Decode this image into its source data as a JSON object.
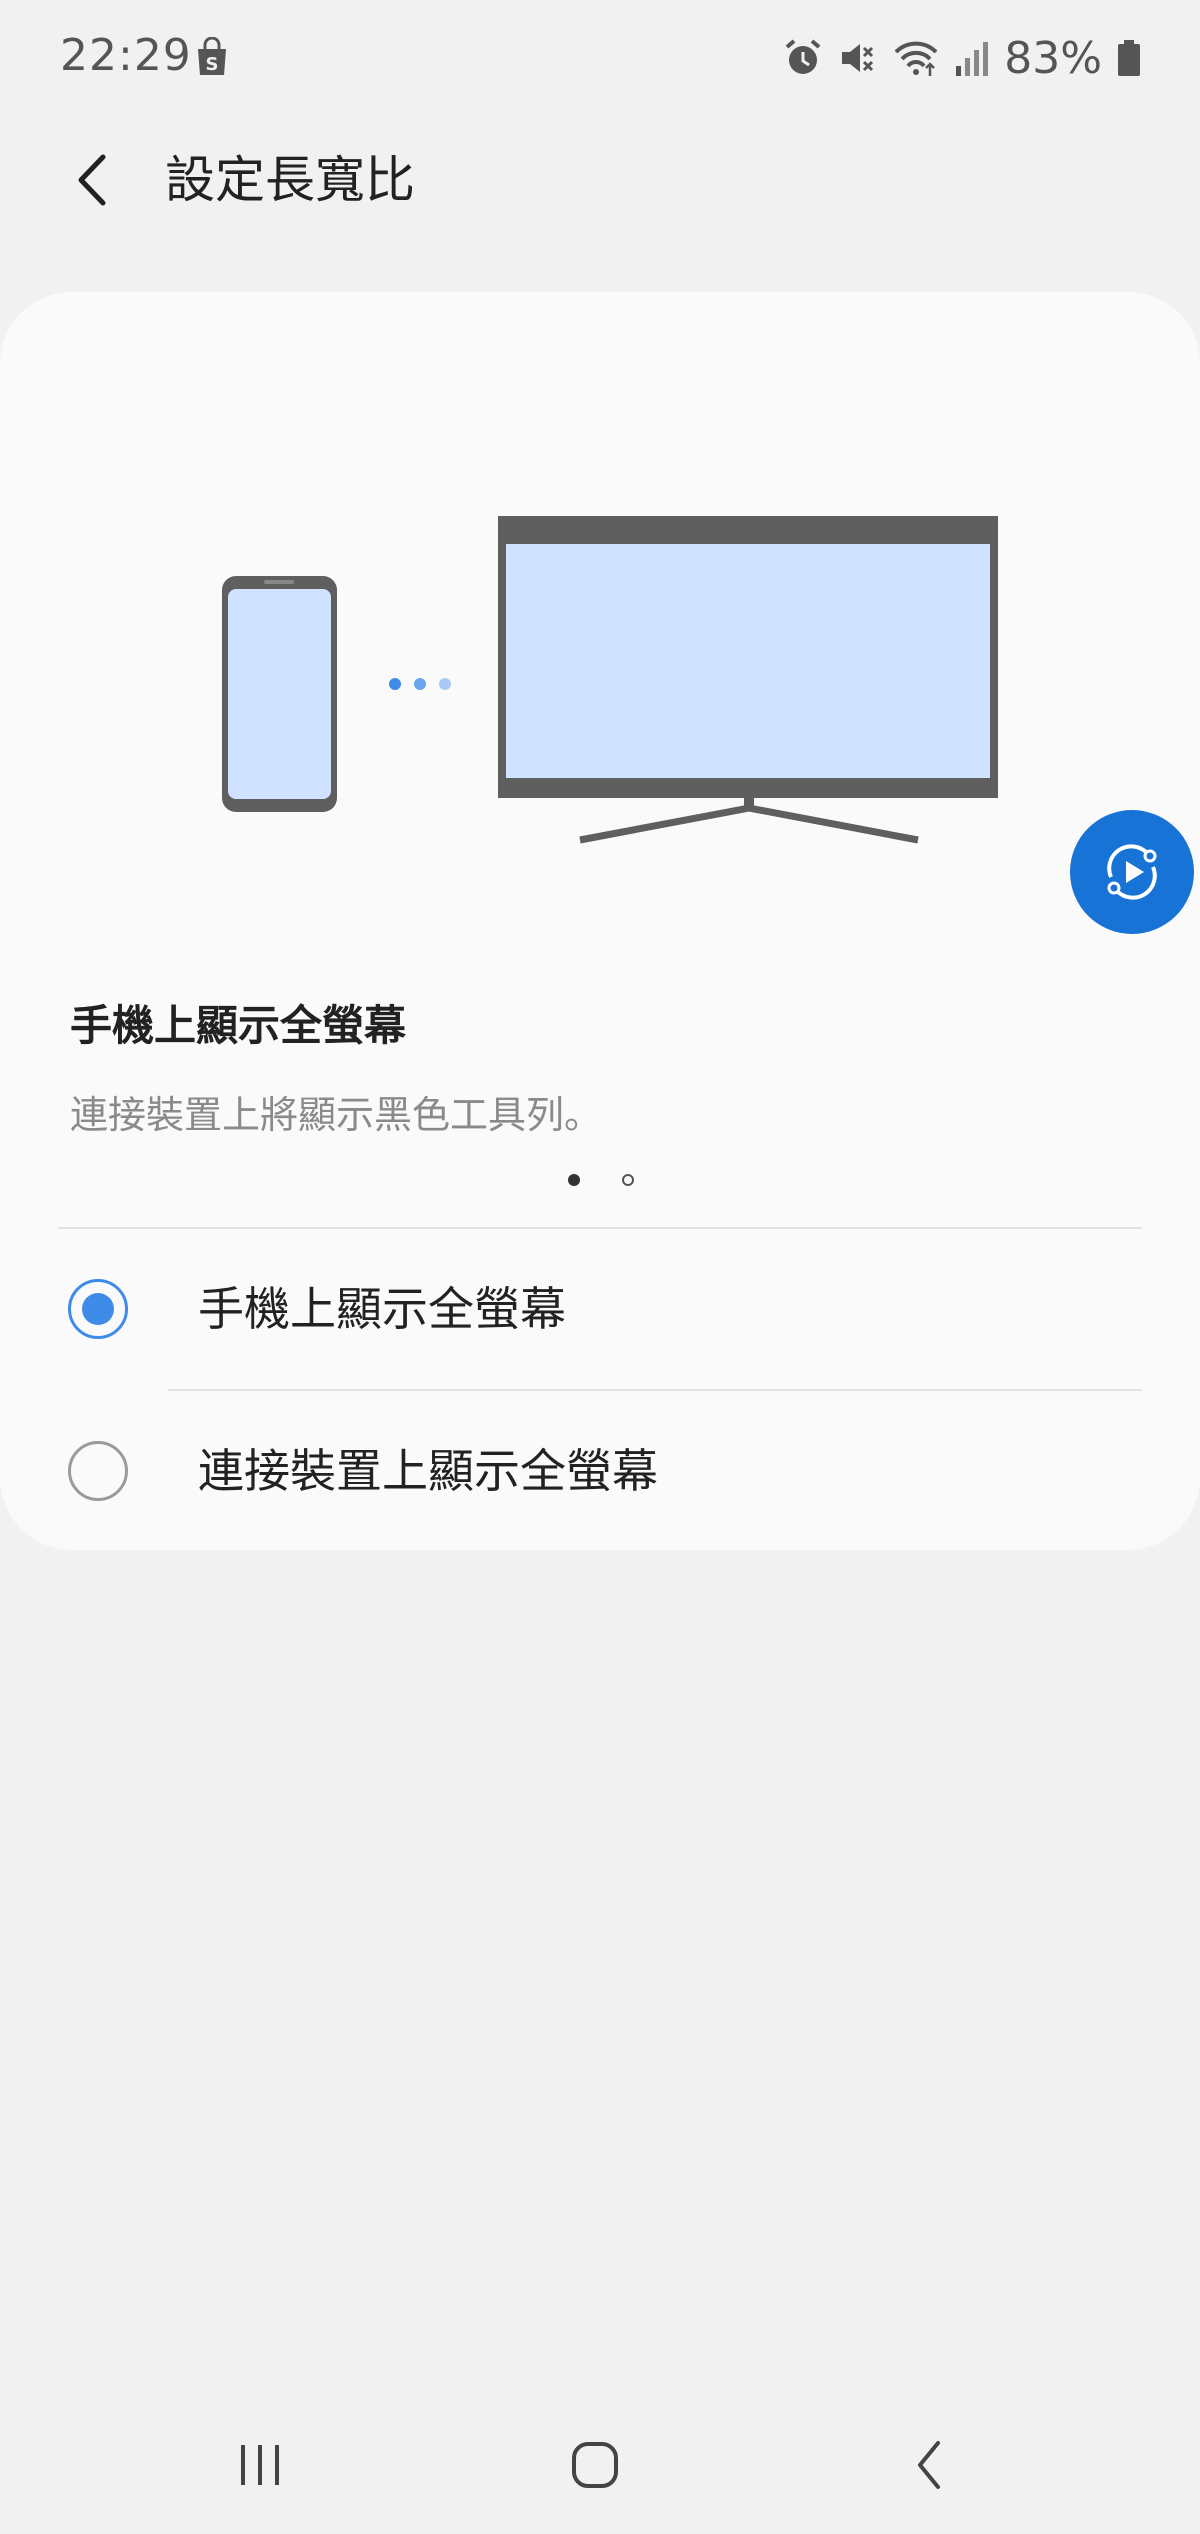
{
  "status_bar": {
    "time": "22:29",
    "battery": "83%",
    "icons": [
      "shopping-bag-icon",
      "alarm-icon",
      "mute-icon",
      "wifi-icon",
      "signal-icon",
      "battery-icon"
    ]
  },
  "header": {
    "title": "設定長寬比",
    "back_icon": "chevron-left-icon"
  },
  "card": {
    "desc_title": "手機上顯示全螢幕",
    "desc_text": "連接裝置上將顯示黑色工具列。",
    "pager": {
      "current": 1,
      "total": 2
    },
    "options": [
      {
        "label": "手機上顯示全螢幕",
        "selected": true
      },
      {
        "label": "連接裝置上顯示全螢幕",
        "selected": false
      }
    ]
  },
  "colors": {
    "accent": "#3e8be8",
    "play_button": "#1873d6",
    "screen_fill": "#cfe2ff",
    "device_frame": "#5f5f5f"
  },
  "nav_bar": {
    "icons": [
      "recents-icon",
      "home-icon",
      "back-icon"
    ]
  }
}
